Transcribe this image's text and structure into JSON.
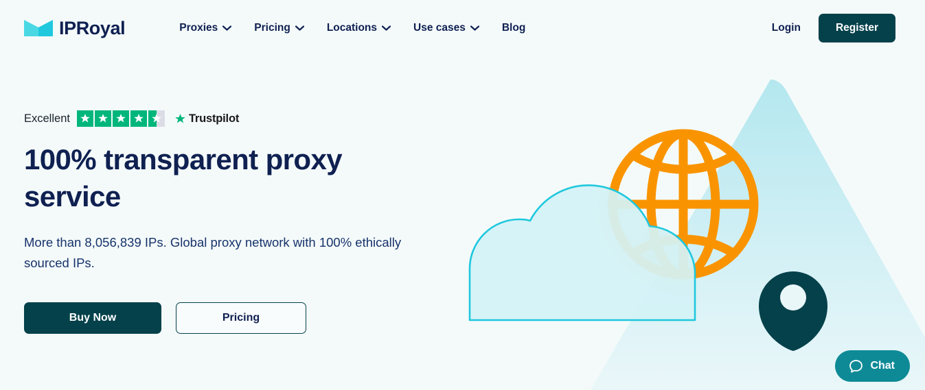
{
  "brand": {
    "name": "IPRoyal",
    "logo_icon": "crown-icon",
    "logo_color_light": "#4ad9e4",
    "logo_color_dark": "#1fc8dd"
  },
  "header": {
    "nav": [
      {
        "label": "Proxies",
        "has_dropdown": true,
        "icon": "chevron-down-icon"
      },
      {
        "label": "Pricing",
        "has_dropdown": true,
        "icon": "chevron-down-icon"
      },
      {
        "label": "Locations",
        "has_dropdown": true,
        "icon": "chevron-down-icon"
      },
      {
        "label": "Use cases",
        "has_dropdown": true,
        "icon": "chevron-down-icon"
      },
      {
        "label": "Blog",
        "has_dropdown": false,
        "icon": ""
      }
    ],
    "login_label": "Login",
    "register_label": "Register",
    "register_bg": "#04414b"
  },
  "hero": {
    "trustpilot": {
      "rating_word": "Excellent",
      "stars_filled": 4,
      "stars_total": 5,
      "half_star": true,
      "brand_name": "Trustpilot",
      "star_icon": "star-icon",
      "green": "#00b67a"
    },
    "title": "100% transparent proxy service",
    "subtitle": "More than 8,056,839 IPs. Global proxy network with 100% ethically sourced IPs.",
    "primary_cta": "Buy Now",
    "secondary_cta": "Pricing",
    "illustration": {
      "mountain_icon": "mountain-triangle-shape",
      "globe_icon": "globe-icon",
      "cloud_icon": "cloud-icon",
      "pin_icon": "map-pin-icon",
      "globe_color": "#f99400",
      "cloud_stroke": "#1fc8dd",
      "cloud_fill": "#d3f2f6",
      "pin_color": "#04414b",
      "mountain_color": "#bfe9ef"
    }
  },
  "chat": {
    "label": "Chat",
    "icon": "chat-bubble-icon",
    "bg": "#0e8a96"
  }
}
